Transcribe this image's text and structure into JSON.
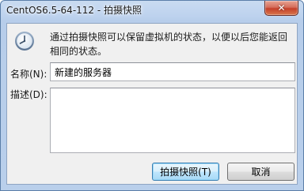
{
  "window": {
    "title": "CentOS6.5-64-112 - 拍摄快照",
    "close_symbol": "✕"
  },
  "icons": {
    "info": "clock-icon",
    "close": "close-icon"
  },
  "info": {
    "text": "通过拍摄快照可以保留虚拟机的状态，以便以后您能返回相同的状态。"
  },
  "form": {
    "name_label": "名称(N):",
    "name_value": "新建的服务器",
    "description_label": "描述(D):",
    "description_value": ""
  },
  "buttons": {
    "snapshot": "拍摄快照(T)",
    "cancel": "取消"
  }
}
